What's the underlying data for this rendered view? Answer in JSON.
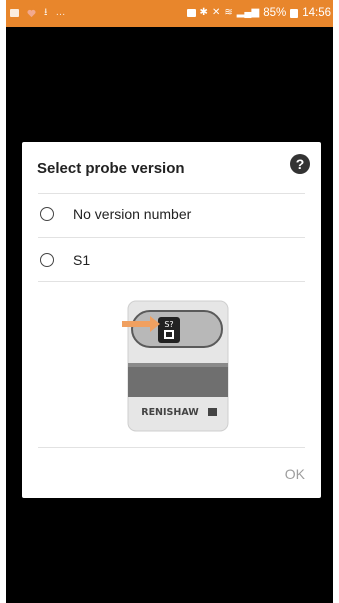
{
  "statusbar": {
    "battery": "85%",
    "time": "14:56"
  },
  "dialog": {
    "title": "Select probe version",
    "options": [
      {
        "label": "No version number"
      },
      {
        "label": "S1"
      }
    ],
    "probe_image": {
      "brand_text": "RENISHAW",
      "version_label": "S?"
    },
    "ok_label": "OK"
  }
}
